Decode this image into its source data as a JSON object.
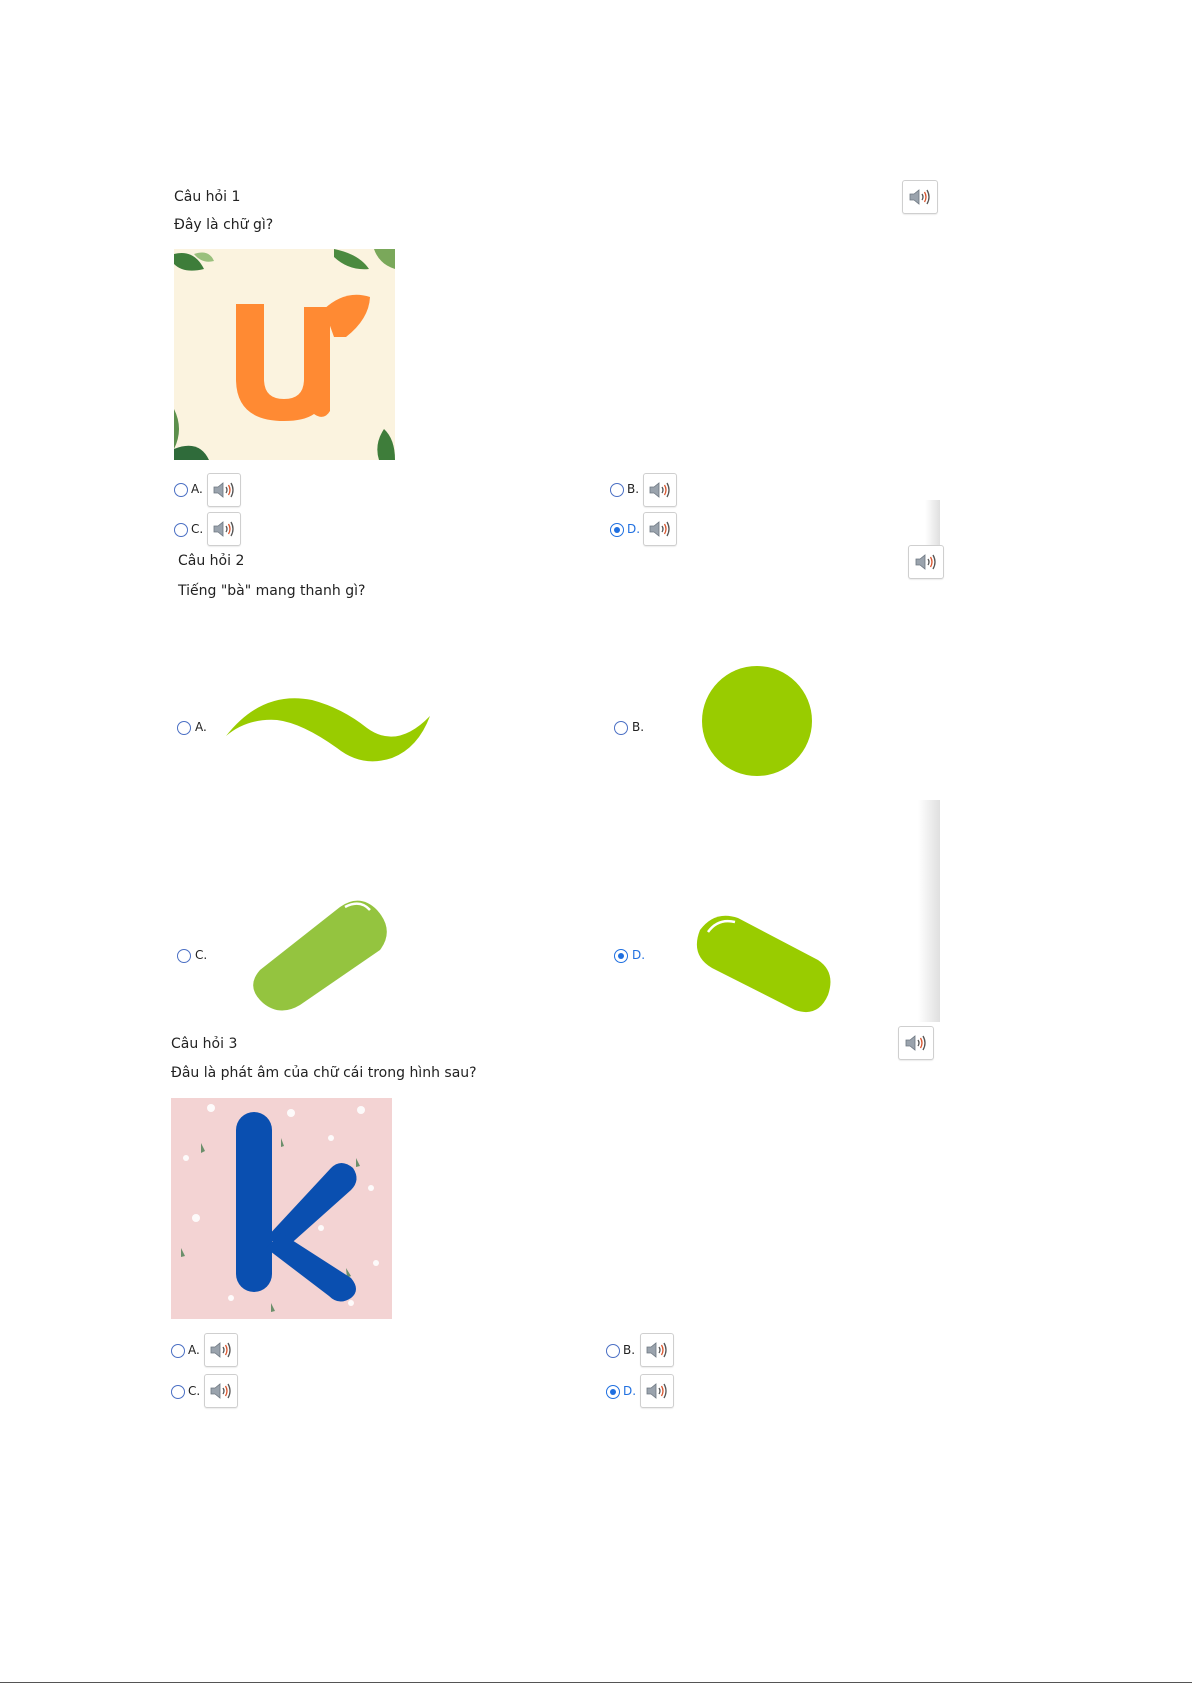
{
  "questions": [
    {
      "title": "Câu hỏi 1",
      "text": "Đây là chữ gì?",
      "image_letter": "ư",
      "options": [
        {
          "letter": "A.",
          "selected": false
        },
        {
          "letter": "B.",
          "selected": false
        },
        {
          "letter": "C.",
          "selected": false
        },
        {
          "letter": "D.",
          "selected": true
        }
      ]
    },
    {
      "title": "Câu hỏi 2",
      "text": "Tiếng \"bà\" mang thanh gì?",
      "options": [
        {
          "letter": "A.",
          "selected": false,
          "icon": "tilde-tone-mark"
        },
        {
          "letter": "B.",
          "selected": false,
          "icon": "dot-tone-mark"
        },
        {
          "letter": "C.",
          "selected": false,
          "icon": "acute-tone-mark"
        },
        {
          "letter": "D.",
          "selected": true,
          "icon": "grave-tone-mark"
        }
      ]
    },
    {
      "title": "Câu hỏi 3",
      "text": "Đâu là phát âm của chữ cái trong hình sau?",
      "image_letter": "k",
      "options": [
        {
          "letter": "A.",
          "selected": false
        },
        {
          "letter": "B.",
          "selected": false
        },
        {
          "letter": "C.",
          "selected": false
        },
        {
          "letter": "D.",
          "selected": true
        }
      ]
    }
  ],
  "colors": {
    "accent_blue": "#1f6fe0",
    "tone_green": "#99cc00",
    "tone_green_dark": "#94c43f",
    "letter_orange": "#ff8a33",
    "letter_blue": "#0a4fb0"
  }
}
